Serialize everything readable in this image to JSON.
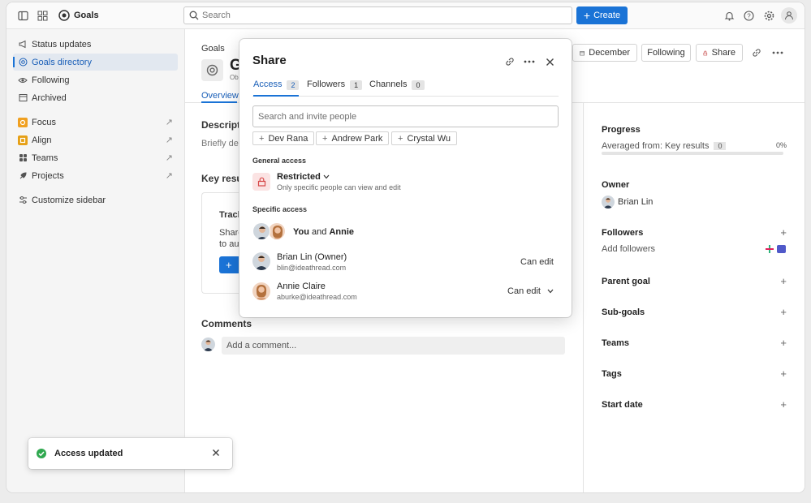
{
  "app": {
    "name": "Goals"
  },
  "topbar": {
    "search_placeholder": "Search",
    "create_label": "Create"
  },
  "sidebar": {
    "items": [
      {
        "label": "Status updates"
      },
      {
        "label": "Goals directory"
      },
      {
        "label": "Following"
      },
      {
        "label": "Archived"
      }
    ],
    "apps": [
      {
        "label": "Focus"
      },
      {
        "label": "Align"
      },
      {
        "label": "Teams"
      },
      {
        "label": "Projects"
      }
    ],
    "customize_label": "Customize sidebar"
  },
  "header": {
    "breadcrumb": "Goals",
    "goal_title_partial": "G",
    "goal_subtitle_partial": "Ob",
    "overview_tab": "Overview",
    "date_label": "December",
    "following_label": "Following",
    "share_label": "Share"
  },
  "main": {
    "description_heading_partial": "Descriptio",
    "description_placeholder_partial": "Briefly des",
    "key_results_heading_partial": "Key resul",
    "track_heading_partial": "Track",
    "share_text_partial_1": "Share",
    "share_text_partial_2": "to aut",
    "comments_heading": "Comments",
    "comment_placeholder": "Add a comment..."
  },
  "right": {
    "progress_title": "Progress",
    "averaged_from": "Averaged from: Key results",
    "averaged_count": "0",
    "progress_percent": "0%",
    "progress_value": 0,
    "owner_title": "Owner",
    "owner_name": "Brian Lin",
    "followers_title": "Followers",
    "add_followers": "Add followers",
    "parent_goal": "Parent goal",
    "sub_goals": "Sub-goals",
    "teams": "Teams",
    "tags": "Tags",
    "start_date": "Start date"
  },
  "modal": {
    "title": "Share",
    "tabs": [
      {
        "label": "Access",
        "count": "2"
      },
      {
        "label": "Followers",
        "count": "1"
      },
      {
        "label": "Channels",
        "count": "0"
      }
    ],
    "invite_placeholder": "Search and invite people",
    "suggestions": [
      "Dev Rana",
      "Andrew Park",
      "Crystal Wu"
    ],
    "general_access_label": "General access",
    "restricted_label": "Restricted",
    "restricted_desc": "Only specific people can view and edit",
    "specific_access_label": "Specific access",
    "you_label": "You",
    "and_label": "and",
    "annie_label": "Annie",
    "people": [
      {
        "name": "Brian Lin (Owner)",
        "email": "blin@ideathread.com",
        "permission": "Can edit"
      },
      {
        "name": "Annie Claire",
        "email": "aburke@ideathread.com",
        "permission": "Can edit"
      }
    ]
  },
  "toast": {
    "message": "Access updated"
  },
  "colors": {
    "accent": "#1a73d6",
    "danger": "#d64545",
    "success": "#2fa84f"
  }
}
